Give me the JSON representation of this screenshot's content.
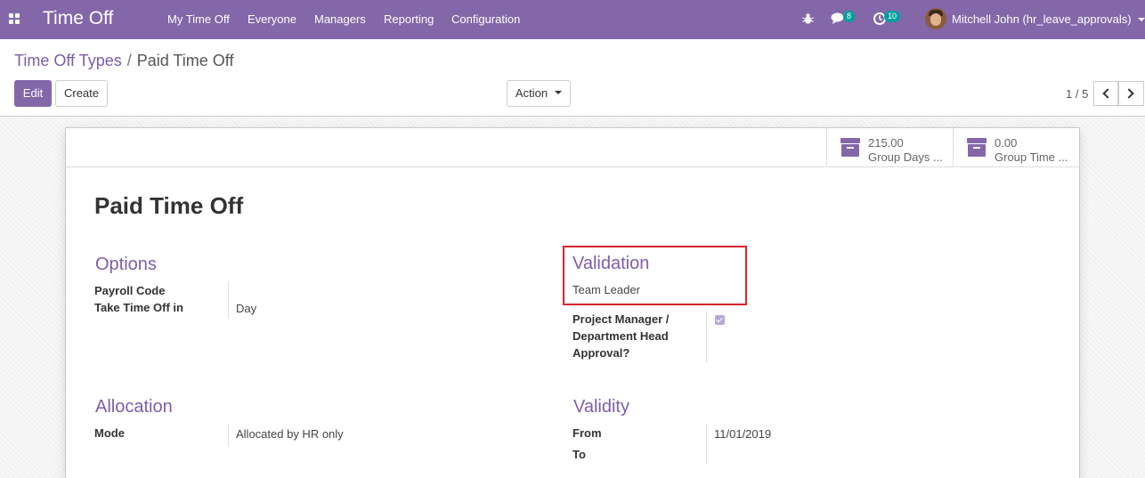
{
  "navbar": {
    "app_title": "Time Off",
    "menu": [
      "My Time Off",
      "Everyone",
      "Managers",
      "Reporting",
      "Configuration"
    ],
    "icons": {
      "apps": "apps-grid-icon",
      "debug": "bug-icon",
      "messages": "chat-icon",
      "activities": "clock-icon"
    },
    "messages_count": "8",
    "activities_count": "10",
    "user_name": "Mitchell John (hr_leave_approvals)",
    "accent_color": "#8367a9",
    "badge_color": "#00a09d"
  },
  "breadcrumb": {
    "parent": "Time Off Types",
    "separator": "/",
    "current": "Paid Time Off"
  },
  "buttons": {
    "edit": "Edit",
    "create": "Create",
    "action": "Action"
  },
  "pager": {
    "value": "1 / 5"
  },
  "stat_buttons": [
    {
      "value": "215.00",
      "label": "Group Days ...",
      "icon": "archive-icon"
    },
    {
      "value": "0.00",
      "label": "Group Time ...",
      "icon": "archive-icon"
    }
  ],
  "record": {
    "title": "Paid Time Off",
    "options": {
      "title": "Options",
      "payroll_code_label": "Payroll Code",
      "payroll_code_value": "",
      "take_time_off_label": "Take Time Off in",
      "take_time_off_value": "Day"
    },
    "validation": {
      "title": "Validation",
      "value": "Team Leader",
      "approval_label": "Project Manager / Department Head Approval?",
      "approval_checked": true,
      "highlight_color": "#d9252c"
    },
    "allocation": {
      "title": "Allocation",
      "mode_label": "Mode",
      "mode_value": "Allocated by HR only"
    },
    "validity": {
      "title": "Validity",
      "from_label": "From",
      "from_value": "11/01/2019",
      "to_label": "To",
      "to_value": ""
    }
  }
}
